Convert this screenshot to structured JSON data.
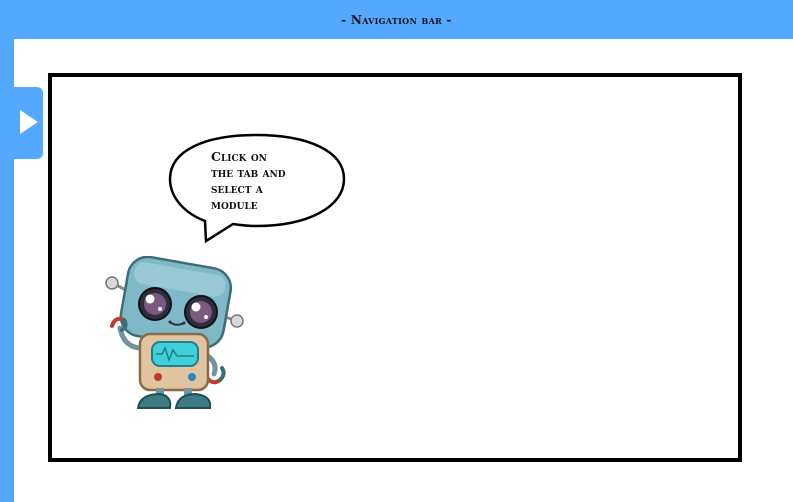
{
  "navbar": {
    "title": "- Navigation bar -"
  },
  "side_tab": {
    "icon": "play-triangle-icon"
  },
  "main": {
    "speech_bubble": {
      "lines": [
        "Click on",
        "the tab and",
        "select a",
        "module"
      ]
    },
    "mascot": {
      "icon": "robot-mascot"
    }
  },
  "colors": {
    "accent": "#55a8ff",
    "frame_border": "#000000",
    "background": "#ffffff"
  }
}
